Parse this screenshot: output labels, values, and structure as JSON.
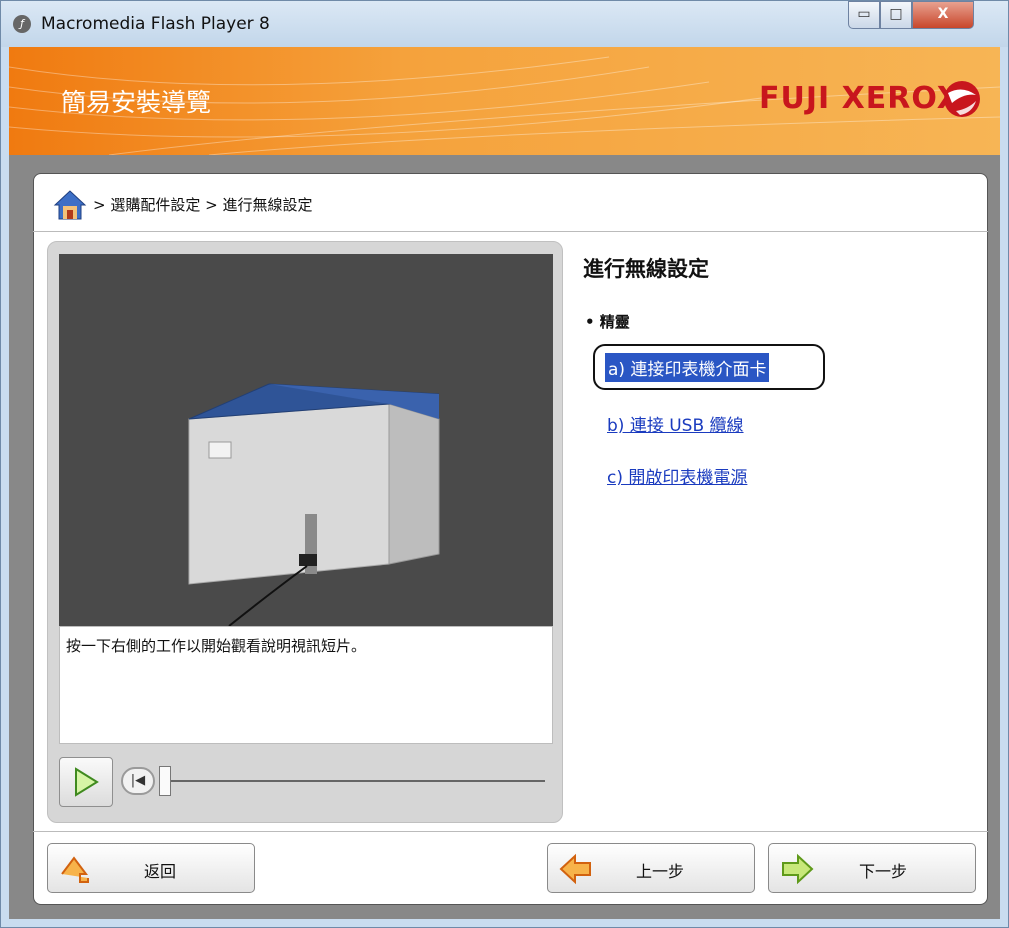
{
  "window": {
    "title": "Macromedia Flash Player 8",
    "minimize_glyph": "▭",
    "maximize_glyph": "□",
    "close_glyph": "X"
  },
  "banner": {
    "title": "簡易安裝導覽",
    "brand": "FUJI XEROX",
    "brand_color": "#c8161d",
    "accent_color": "#f07a10"
  },
  "breadcrumb": {
    "text": "> 選購配件設定 > 進行無線設定"
  },
  "video": {
    "caption": "按一下右側的工作以開始觀看說明視訊短片。",
    "progress": 0
  },
  "content": {
    "title": "進行無線設定",
    "bullet": "• 精靈",
    "links": [
      {
        "label": "a) 連接印表機介面卡",
        "selected": true
      },
      {
        "label": "b) 連接 USB 纜線",
        "selected": false
      },
      {
        "label": "c) 開啟印表機電源",
        "selected": false
      }
    ]
  },
  "nav": {
    "back_label": "返回",
    "prev_label": "上一步",
    "next_label": "下一步"
  },
  "icons": {
    "home": "home-icon",
    "play": "play-icon",
    "rewind": "rewind-icon"
  }
}
